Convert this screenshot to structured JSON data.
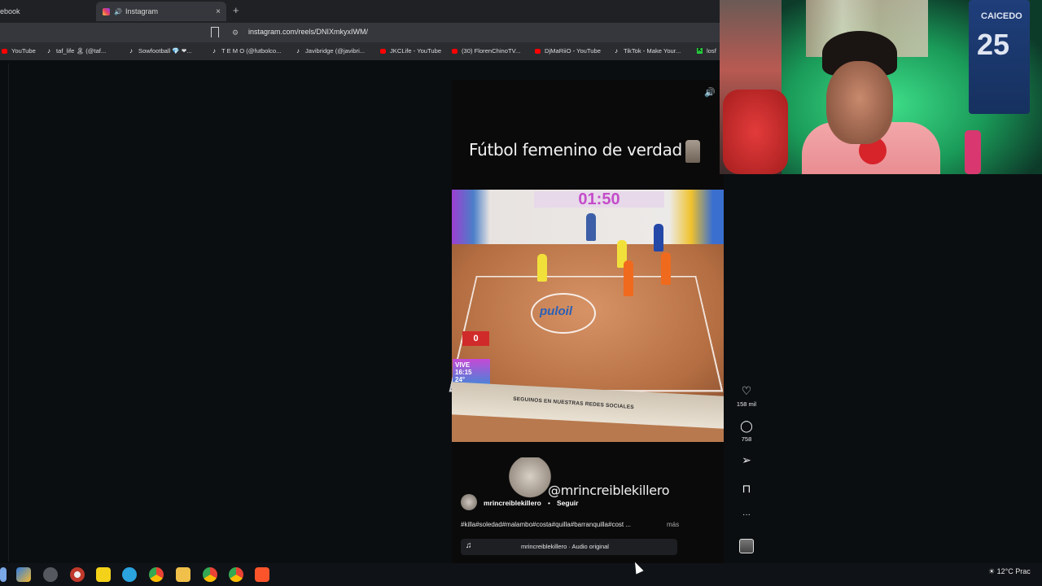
{
  "browser": {
    "tabs": [
      {
        "label": "ebook"
      },
      {
        "label": "Instagram"
      }
    ],
    "new_tab": "+",
    "tab_close": "×",
    "url": "instagram.com/reels/DNIXmkyxIWM/",
    "bookmarks": [
      {
        "label": "YouTube",
        "icon": "youtube-icon"
      },
      {
        "label": "taf_life 🏝 (@taf...",
        "icon": "tiktok-icon"
      },
      {
        "label": "Sowfootball 💎 ❤...",
        "icon": "tiktok-icon"
      },
      {
        "label": "T E M O (@futbolco...",
        "icon": "tiktok-icon"
      },
      {
        "label": "Javibridge (@javibri...",
        "icon": "tiktok-icon"
      },
      {
        "label": "JKCLife - YouTube",
        "icon": "youtube-icon"
      },
      {
        "label": "(30) FlorenChinoTV...",
        "icon": "youtube-icon"
      },
      {
        "label": "DjMaRiiO - YouTube",
        "icon": "youtube-icon"
      },
      {
        "label": "TikTok - Make Your...",
        "icon": "tiktok-icon"
      },
      {
        "label": "losf",
        "icon": "kick-icon"
      }
    ]
  },
  "reel": {
    "overlay_title": "Fútbol femenino de verdad",
    "scoreboard": "01:50",
    "center_logo": "puloil",
    "score": "0",
    "vive_badge": "VIVE",
    "vive_time": "16:15",
    "vive_temp": "24°",
    "banner_text": "SEGUINOS EN NUESTRAS REDES SOCIALES",
    "watermark": "@mrincreiblekillero",
    "username": "mrincreiblekillero",
    "dot": "•",
    "follow": "Seguir",
    "hashtags": "#killa#soledad#malambo#costa#quilla#barranquilla#cost ...",
    "more": "más",
    "audio": "mrincreiblekillero · Audio original"
  },
  "actions": {
    "likes": "158 mil",
    "comments": "758",
    "more_icon": "···"
  },
  "webcam": {
    "shirt_name": "CAICEDO",
    "shirt_number": "25"
  },
  "taskbar": {
    "weather": "12°C",
    "weather_desc": "Prac"
  }
}
